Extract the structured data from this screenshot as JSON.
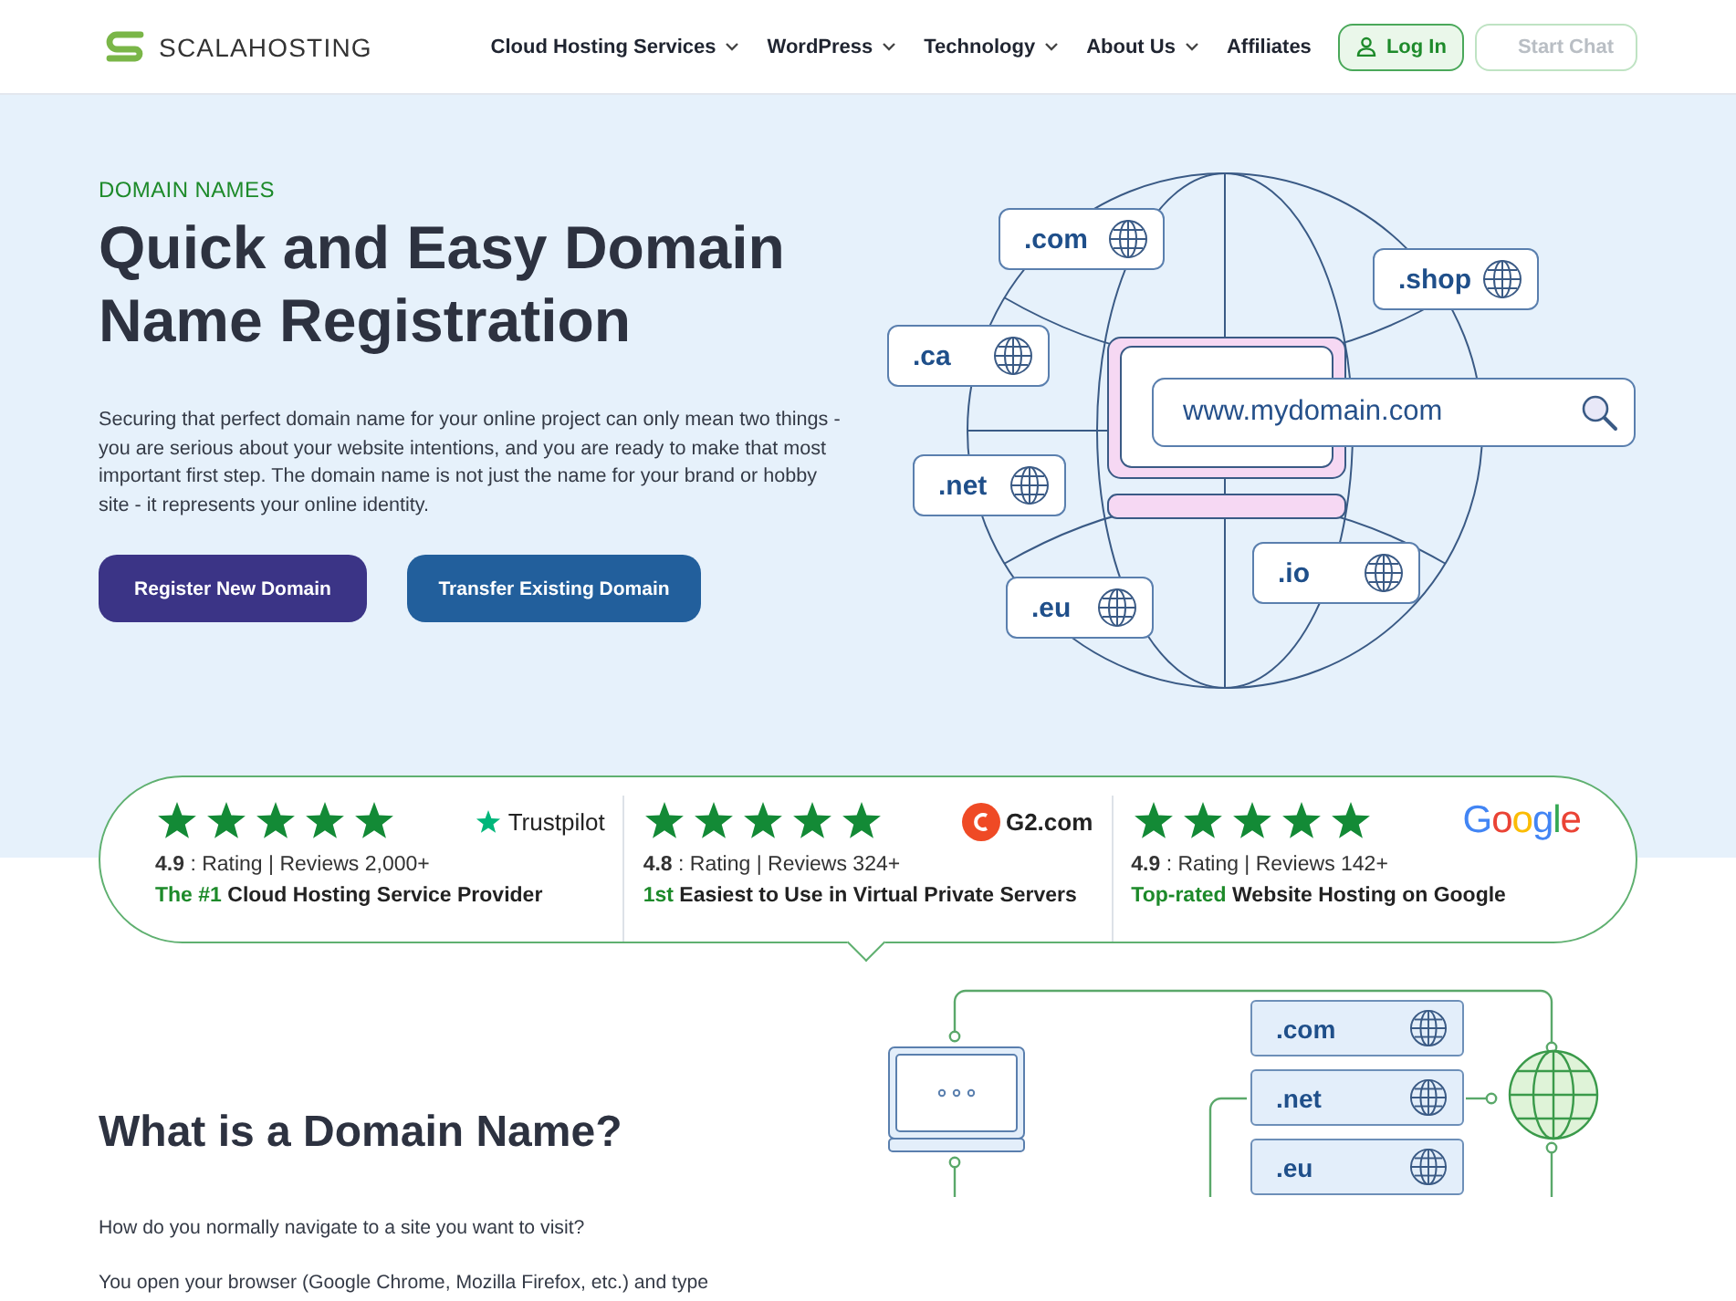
{
  "header": {
    "logo": "SCALAHOSTING",
    "nav": [
      {
        "label": "Cloud Hosting Services",
        "has_dropdown": true
      },
      {
        "label": "WordPress",
        "has_dropdown": true
      },
      {
        "label": "Technology",
        "has_dropdown": true
      },
      {
        "label": "About Us",
        "has_dropdown": true
      },
      {
        "label": "Affiliates",
        "has_dropdown": false
      }
    ],
    "buttons": [
      {
        "label": "Log In",
        "kind": "login",
        "disabled": false
      },
      {
        "label": "Start Chat",
        "kind": "chat",
        "disabled": true
      }
    ]
  },
  "hero": {
    "eyebrow": "DOMAIN NAMES",
    "title": "Quick and Easy Domain Name Registration",
    "description": "Securing that perfect domain name for your online project can only mean two things - you are serious about your website intentions, and you are ready to make that most important first step. The domain name is not just the name for your brand or hobby site - it represents your online identity.",
    "buttons": [
      {
        "label": "Register New Domain",
        "kind": "primary"
      },
      {
        "label": "Transfer Existing Domain",
        "kind": "secondary"
      }
    ],
    "illustration": {
      "search_text": "www.mydomain.com",
      "tlds": [
        ".com",
        ".shop",
        ".ca",
        ".net",
        ".eu",
        ".io"
      ]
    }
  },
  "ratings": [
    {
      "brand": "Trustpilot",
      "kind": "trustpilot",
      "stars": 5,
      "score": "4.9",
      "detail": ": Rating | Reviews 2,000+",
      "highlight": "The #1",
      "tagline": "Cloud Hosting Service Provider"
    },
    {
      "brand": "G2.com",
      "kind": "g2",
      "stars": 5,
      "score": "4.8",
      "detail": ": Rating | Reviews 324+",
      "highlight": "1st",
      "tagline": "Easiest to Use in Virtual Private Servers"
    },
    {
      "brand": "Google",
      "kind": "google",
      "stars": 5,
      "score": "4.9",
      "detail": ": Rating | Reviews 142+",
      "highlight": "Top-rated",
      "tagline": "Website Hosting on Google"
    }
  ],
  "about": {
    "heading": "What is a Domain Name?",
    "paragraphs": [
      "How do you normally navigate to a site you want to visit?",
      "You open your browser (Google Chrome, Mozilla Firefox, etc.) and type"
    ],
    "diagram": {
      "tlds": [
        ".com",
        ".net",
        ".eu"
      ]
    }
  }
}
